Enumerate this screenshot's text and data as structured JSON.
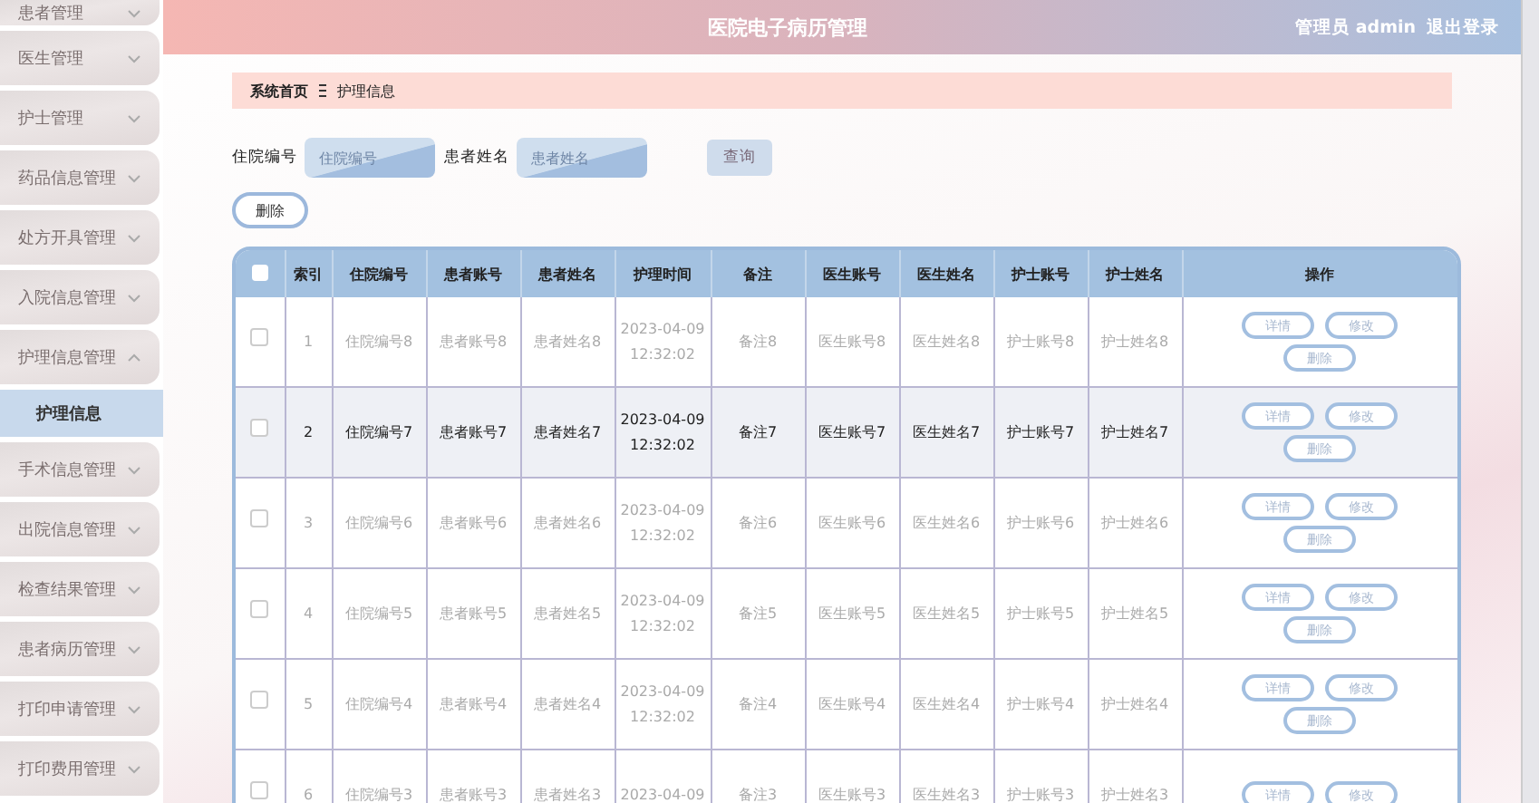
{
  "sidebar": {
    "items": [
      {
        "label": "患者管理",
        "expanded": false
      },
      {
        "label": "医生管理",
        "expanded": false
      },
      {
        "label": "护士管理",
        "expanded": false
      },
      {
        "label": "药品信息管理",
        "expanded": false
      },
      {
        "label": "处方开具管理",
        "expanded": false
      },
      {
        "label": "入院信息管理",
        "expanded": false
      },
      {
        "label": "护理信息管理",
        "expanded": true,
        "children": [
          {
            "label": "护理信息",
            "selected": true
          }
        ]
      },
      {
        "label": "手术信息管理",
        "expanded": false
      },
      {
        "label": "出院信息管理",
        "expanded": false
      },
      {
        "label": "检查结果管理",
        "expanded": false
      },
      {
        "label": "患者病历管理",
        "expanded": false
      },
      {
        "label": "打印申请管理",
        "expanded": false
      },
      {
        "label": "打印费用管理",
        "expanded": false
      }
    ]
  },
  "header": {
    "title": "医院电子病历管理",
    "user": "管理员 admin",
    "logout": "退出登录"
  },
  "breadcrumb": [
    "系统首页",
    "护理信息"
  ],
  "search": {
    "fields": [
      {
        "label": "住院编号",
        "placeholder": "住院编号"
      },
      {
        "label": "患者姓名",
        "placeholder": "患者姓名"
      }
    ],
    "button": "查询"
  },
  "delete_button": "删除",
  "table": {
    "all_checked": false,
    "columns": [
      "索引",
      "住院编号",
      "患者账号",
      "患者姓名",
      "护理时间",
      "备注",
      "医生账号",
      "医生姓名",
      "护士账号",
      "护士姓名",
      "操作"
    ],
    "rows": [
      {
        "checked": false,
        "highlighted": false,
        "cells": [
          "1",
          "住院编号8",
          "患者账号8",
          "患者姓名8",
          "2023-04-09 12:32:02",
          "备注8",
          "医生账号8",
          "医生姓名8",
          "护士账号8",
          "护士姓名8"
        ],
        "actions": [
          "详情",
          "修改",
          "删除"
        ]
      },
      {
        "checked": false,
        "highlighted": true,
        "cells": [
          "2",
          "住院编号7",
          "患者账号7",
          "患者姓名7",
          "2023-04-09 12:32:02",
          "备注7",
          "医生账号7",
          "医生姓名7",
          "护士账号7",
          "护士姓名7"
        ],
        "actions": [
          "详情",
          "修改",
          "删除"
        ]
      },
      {
        "checked": false,
        "highlighted": false,
        "cells": [
          "3",
          "住院编号6",
          "患者账号6",
          "患者姓名6",
          "2023-04-09 12:32:02",
          "备注6",
          "医生账号6",
          "医生姓名6",
          "护士账号6",
          "护士姓名6"
        ],
        "actions": [
          "详情",
          "修改",
          "删除"
        ]
      },
      {
        "checked": false,
        "highlighted": false,
        "cells": [
          "4",
          "住院编号5",
          "患者账号5",
          "患者姓名5",
          "2023-04-09 12:32:02",
          "备注5",
          "医生账号5",
          "医生姓名5",
          "护士账号5",
          "护士姓名5"
        ],
        "actions": [
          "详情",
          "修改",
          "删除"
        ]
      },
      {
        "checked": false,
        "highlighted": false,
        "cells": [
          "5",
          "住院编号4",
          "患者账号4",
          "患者姓名4",
          "2023-04-09 12:32:02",
          "备注4",
          "医生账号4",
          "医生姓名4",
          "护士账号4",
          "护士姓名4"
        ],
        "actions": [
          "详情",
          "修改",
          "删除"
        ]
      },
      {
        "checked": false,
        "highlighted": false,
        "cells": [
          "6",
          "住院编号3",
          "患者账号3",
          "患者姓名3",
          "2023-04-09",
          "备注3",
          "医生账号3",
          "医生姓名3",
          "护士账号3",
          "护士姓名3"
        ],
        "actions": [
          "详情",
          "修改"
        ]
      }
    ]
  }
}
